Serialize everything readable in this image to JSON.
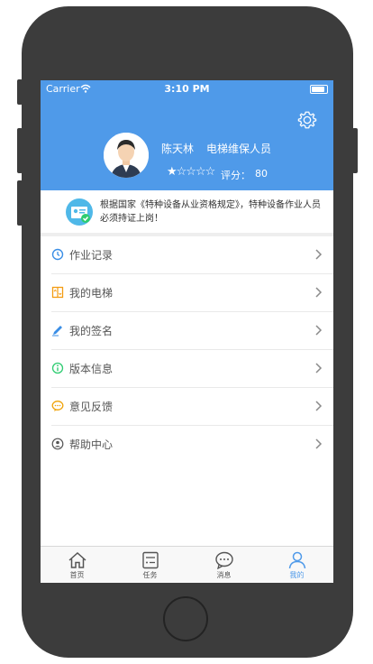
{
  "status_bar": {
    "carrier": "Carrier",
    "time": "3:10 PM"
  },
  "profile": {
    "name": "陈天林",
    "role": "电梯维保人员",
    "stars": "★☆☆☆☆",
    "rating_stars": 1,
    "score_label": "评分：",
    "score_value": "80"
  },
  "notice": {
    "text": "根据国家《特种设备从业资格规定》，特种设备作业人员必须持证上岗！"
  },
  "menu": [
    {
      "label": "作业记录",
      "icon": "history-icon",
      "color": "#3a8ee6"
    },
    {
      "label": "我的电梯",
      "icon": "elevator-icon",
      "color": "#f39c12"
    },
    {
      "label": "我的签名",
      "icon": "pen-icon",
      "color": "#3a8ee6"
    },
    {
      "label": "版本信息",
      "icon": "info-icon",
      "color": "#2ecc71"
    },
    {
      "label": "意见反馈",
      "icon": "feedback-icon",
      "color": "#f0a30a"
    },
    {
      "label": "帮助中心",
      "icon": "help-icon",
      "color": "#555555"
    }
  ],
  "tabs": [
    {
      "label": "首页",
      "icon": "home-icon",
      "active": false
    },
    {
      "label": "任务",
      "icon": "tasks-icon",
      "active": false
    },
    {
      "label": "消息",
      "icon": "message-icon",
      "active": false
    },
    {
      "label": "我的",
      "icon": "profile-icon",
      "active": true
    }
  ],
  "colors": {
    "header": "#4f9ae9",
    "accent": "#4f9ae9",
    "phone_frame": "#3c3c3c"
  }
}
